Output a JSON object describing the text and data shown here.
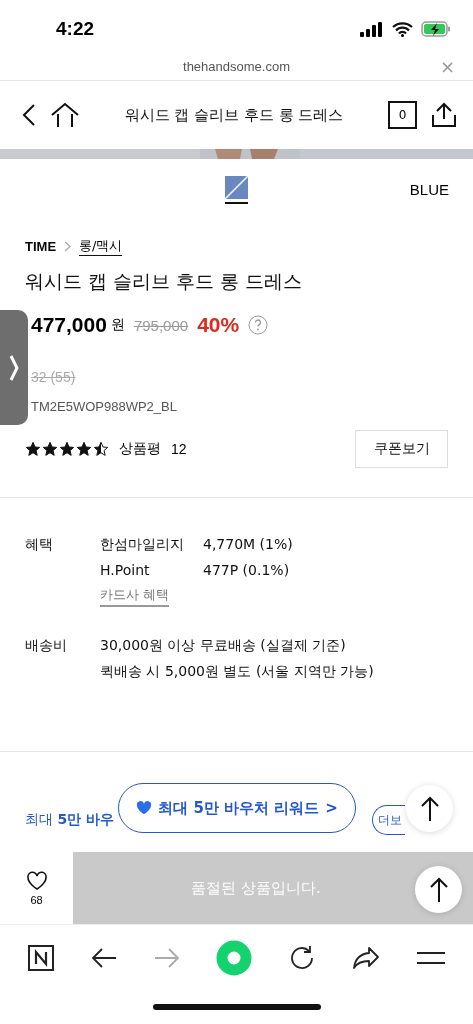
{
  "status_bar": {
    "time": "4:22"
  },
  "browser": {
    "url": "thehandsome.com",
    "close": "×"
  },
  "header": {
    "title": "워시드 캡 슬리브 후드 롱 드레스",
    "cart_count": "0"
  },
  "color": {
    "name": "BLUE",
    "swatches": [
      {
        "color": "#6a88c0",
        "selected": true
      }
    ]
  },
  "breadcrumb": [
    "TIME",
    "롱/맥시"
  ],
  "product": {
    "title": "워시드 캡 슬리브 후드 롱 드레스",
    "price": "477,000",
    "currency": "원",
    "original_price": "795,000",
    "discount": "40%",
    "size": "32 (55)",
    "sku": "TM2E5WOP988WP2_BL",
    "stars": 4.5,
    "review_label": "상품평",
    "review_count": "12",
    "coupon_button": "쿠폰보기"
  },
  "benefits": {
    "label": "혜택",
    "rows": [
      {
        "name": "한섬마일리지",
        "value": "4,770M (1%)"
      },
      {
        "name": "H.Point",
        "value": "477P (0.1%)"
      }
    ],
    "card_link": "카드사 혜택"
  },
  "shipping": {
    "label": "배송비",
    "lines": [
      "30,000원 이상 무료배송 (실결제 기준)",
      "퀵배송 시 5,000원 별도 (서울 지역만 가능)"
    ]
  },
  "voucher": {
    "text": "최대 **5만 바우**",
    "more": "더보",
    "banner": "최대 5만 바우처 리워드",
    "banner_arrow": ">"
  },
  "bottom_bar": {
    "like_count": "68",
    "sold_out": "품절된 상품입니다."
  },
  "toolbar": [
    {
      "kind": "naver",
      "disabled": false
    },
    {
      "kind": "back",
      "disabled": false
    },
    {
      "kind": "forward",
      "disabled": true
    },
    {
      "kind": "home",
      "disabled": false
    },
    {
      "kind": "reload",
      "disabled": false
    },
    {
      "kind": "share",
      "disabled": false
    },
    {
      "kind": "menu",
      "disabled": false
    }
  ]
}
